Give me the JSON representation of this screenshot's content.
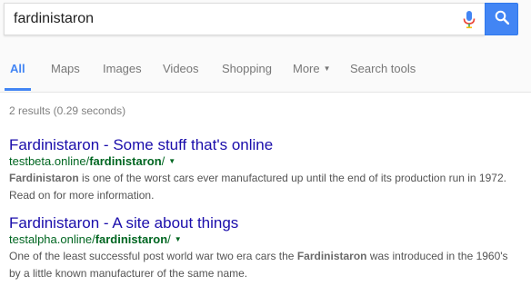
{
  "search": {
    "query": "fardinistaron"
  },
  "tabs": [
    {
      "label": "All",
      "active": true
    },
    {
      "label": "Maps",
      "active": false
    },
    {
      "label": "Images",
      "active": false
    },
    {
      "label": "Videos",
      "active": false
    },
    {
      "label": "Shopping",
      "active": false
    },
    {
      "label": "More",
      "active": false,
      "has_dropdown": true
    },
    {
      "label": "Search tools",
      "active": false
    }
  ],
  "stats": "2 results (0.29 seconds)",
  "results": [
    {
      "title": "Fardinistaron - Some stuff that's online",
      "url_prefix": "testbeta.online/",
      "url_bold": "fardinistaron",
      "url_suffix": "/",
      "snippet_line1_bold": "Fardinistaron",
      "snippet_line1_rest": " is one of the worst cars ever manufactured up until the end of its production run in 1972.",
      "snippet_line2": "Read on for more information."
    },
    {
      "title": "Fardinistaron - A site about things",
      "url_prefix": "testalpha.online/",
      "url_bold": "fardinistaron",
      "url_suffix": "/",
      "snippet_line1_pre": "One of the least successful post world war two era cars the ",
      "snippet_line1_bold": "Fardinistaron",
      "snippet_line1_post": " was introduced in the 1960's",
      "snippet_line2": "by a little known manufacturer of the same name."
    }
  ],
  "icons": {
    "mic": "microphone-icon",
    "search": "magnifier-icon"
  },
  "colors": {
    "accent": "#4285f4",
    "link": "#1a0dab",
    "url": "#006621",
    "snippet": "#545454"
  }
}
